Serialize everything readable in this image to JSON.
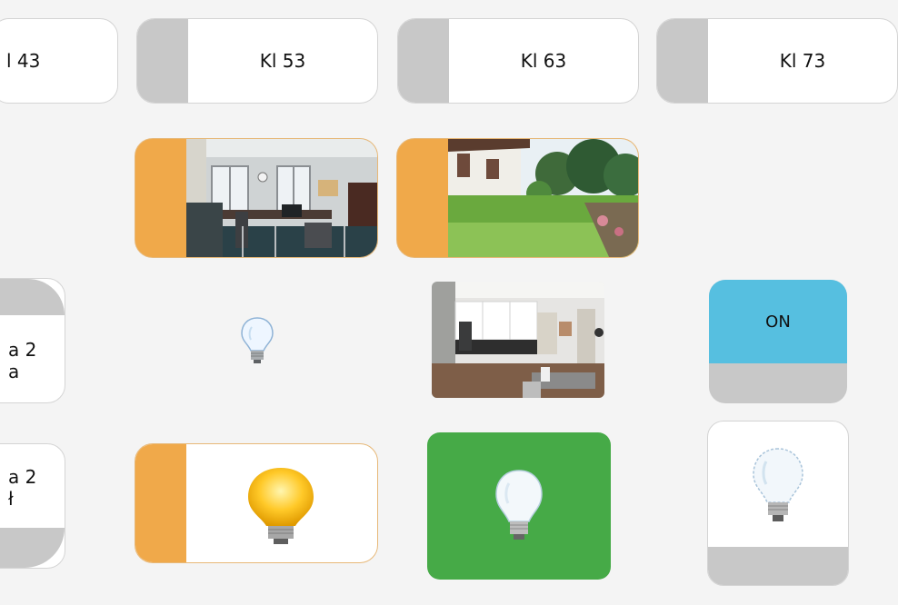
{
  "top_row": {
    "btn1_label": "l 43",
    "btn2_label": "Kl 53",
    "btn3_label": "Kl 63",
    "btn4_label": "Kl 73"
  },
  "left_partial": {
    "card1_line1": "a 2",
    "card1_line2": "a",
    "card2_line1": "a 2",
    "card2_line2": "ł"
  },
  "on_tile": {
    "label": "ON"
  },
  "icons": {
    "room_office": "office-room-photo",
    "room_garden": "garden-photo",
    "room_kitchen": "kitchen-photo",
    "bulb": "light-bulb-icon"
  },
  "colors": {
    "accent_orange": "#f0a94a",
    "gray_side": "#c8c8c8",
    "on_blue": "#56bfe0",
    "green": "#46aa47",
    "bg": "#f4f4f4"
  }
}
